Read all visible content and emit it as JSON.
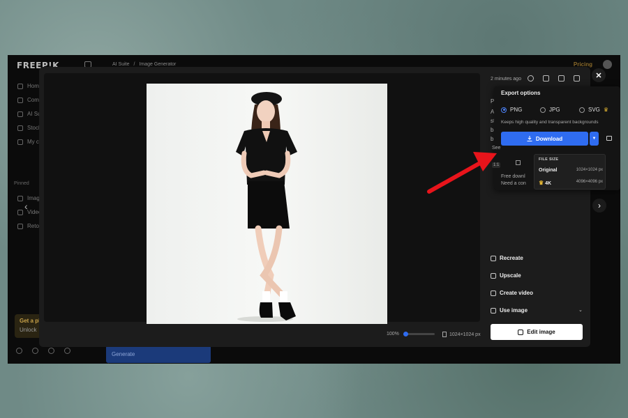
{
  "app": {
    "logo": "FREEP!K",
    "breadcrumbs": [
      "AI Suite",
      "/",
      "Image Generator"
    ],
    "pricing": "Pricing"
  },
  "sidebar": {
    "items": [
      "Home",
      "Community",
      "AI Suite",
      "Stock",
      "My creations"
    ],
    "pinned_label": "Pinned",
    "pinned_items": [
      "Image Generator",
      "Video Generator",
      "Retouch"
    ],
    "promo_title": "Get a plan",
    "promo_text": "Unlock"
  },
  "generate_label": "Generate",
  "preview": {
    "zoom": "100%",
    "dimensions": "1024×1024 px"
  },
  "panel": {
    "time": "2 minutes ago",
    "prompt_fragments": [
      "Pro",
      "A W",
      "sta",
      "bac",
      "bla"
    ],
    "actions": [
      "Recreate",
      "Upscale",
      "Create video",
      "Use image"
    ],
    "edit_label": "Edit image"
  },
  "export": {
    "title": "Export options",
    "formats": [
      "PNG",
      "JPG",
      "SVG"
    ],
    "selected": "PNG",
    "description": "Keeps high quality and transparent backgrounds",
    "download_label": "Download",
    "fragments": {
      "see": "See",
      "ratio": "1:1",
      "free": "Free downl",
      "need": "Need a con"
    }
  },
  "file_size": {
    "title": "FILE SIZE",
    "options": [
      {
        "label": "Original",
        "size": "1024×1024 px",
        "premium": false
      },
      {
        "label": "4K",
        "size": "4096×4096 px",
        "premium": true
      }
    ]
  },
  "colors": {
    "accent": "#2f6cf0",
    "premium": "#e3b634",
    "annotation_arrow": "#e8141b"
  }
}
